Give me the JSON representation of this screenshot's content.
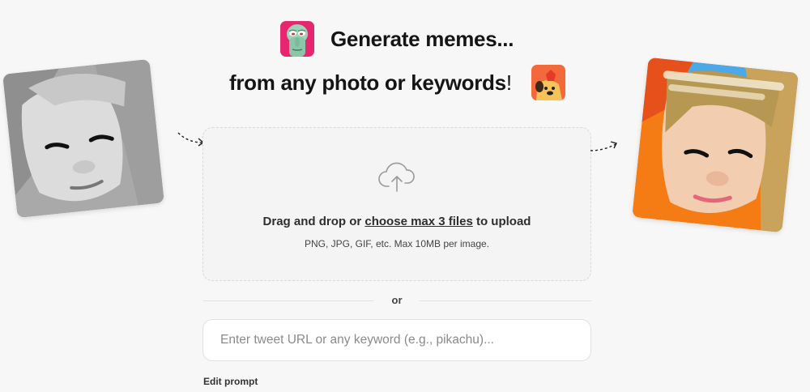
{
  "header": {
    "line1": "Generate memes...",
    "line2": "from any photo or keywords",
    "line2_punct": "!"
  },
  "dropzone": {
    "text_before": "Drag and drop or ",
    "link": "choose max 3 files",
    "text_after": " to upload",
    "hint": "PNG, JPG, GIF, etc. Max 10MB per image."
  },
  "divider": {
    "label": "or"
  },
  "search": {
    "placeholder": "Enter tweet URL or any keyword (e.g., pikachu)...",
    "value": ""
  },
  "edit_prompt_label": "Edit prompt",
  "icons": {
    "sticker_1": "squidward-sticker-icon",
    "sticker_2": "dog-sticker-icon",
    "upload": "cloud-upload-icon",
    "arrow_left": "dashed-arrow-icon",
    "arrow_right": "dashed-arrow-icon"
  },
  "colors": {
    "background": "#f7f7f7",
    "sticker_1_bg": "#e8256f",
    "sticker_2_bg": "#f26a3b",
    "right_photo_accent": "#f57b14"
  }
}
